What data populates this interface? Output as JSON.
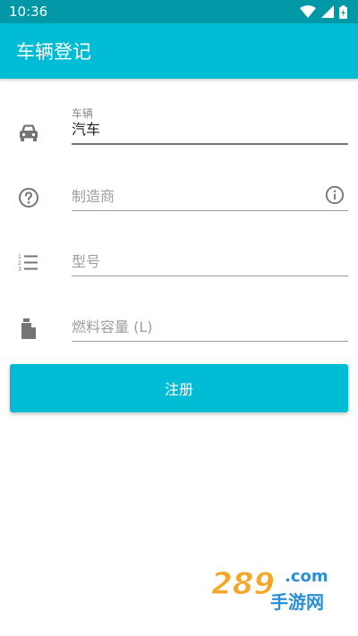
{
  "status_bar": {
    "time": "10:36",
    "icons": [
      "wifi-icon",
      "signal-icon",
      "battery-icon"
    ]
  },
  "app_bar": {
    "title": "车辆登记"
  },
  "form": {
    "vehicle": {
      "label": "车辆",
      "value": "汽车",
      "icon": "car-icon"
    },
    "manufacturer": {
      "placeholder": "制造商",
      "icon": "help-circle-icon",
      "trailing_icon": "info-icon"
    },
    "model": {
      "placeholder": "型号",
      "icon": "numbered-list-icon"
    },
    "fuel_capacity": {
      "placeholder": "燃料容量 (L)",
      "icon": "fuel-can-icon"
    }
  },
  "actions": {
    "register_label": "注册"
  },
  "watermark": {
    "number": "289",
    "domain": ".com",
    "caption": "手游网"
  },
  "colors": {
    "primary": "#00bcd4",
    "primary_dark": "#0097a7",
    "icon_gray": "#757575",
    "text_dark": "#212121"
  }
}
